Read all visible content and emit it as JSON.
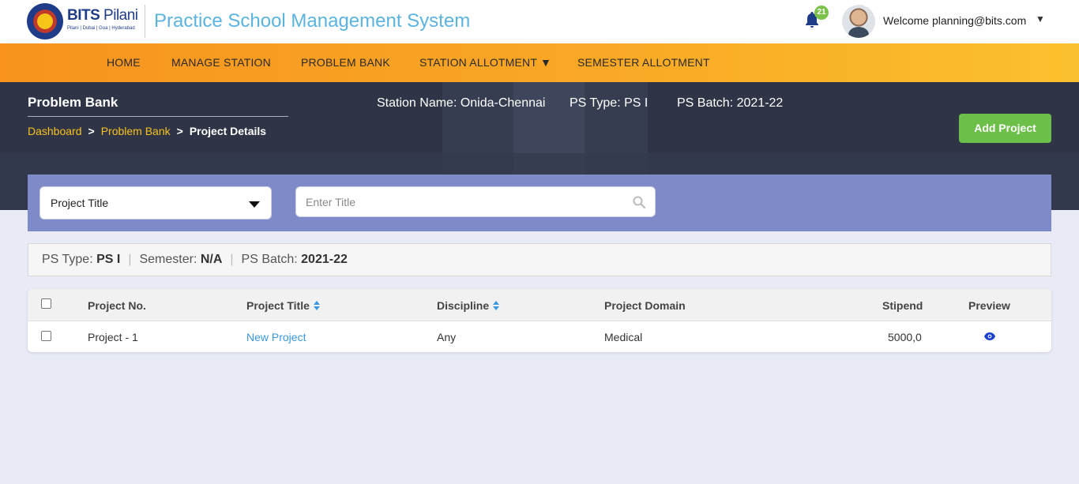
{
  "header": {
    "logo_text_bold": "BITS",
    "logo_text_thin": " Pilani",
    "logo_subtext": "Pilani | Dubai | Goa | Hyderabad",
    "app_title": "Practice School Management System",
    "notification_count": "21",
    "welcome_text": "Welcome planning@bits.com",
    "user_menu_caret": "▼"
  },
  "nav": {
    "items": [
      {
        "label": "HOME"
      },
      {
        "label": "MANAGE STATION"
      },
      {
        "label": "PROBLEM BANK"
      },
      {
        "label": "STATION ALLOTMENT ▼"
      },
      {
        "label": "SEMESTER ALLOTMENT"
      }
    ]
  },
  "hero": {
    "page_title": "Problem Bank",
    "breadcrumb": {
      "items": [
        "Dashboard",
        "Problem Bank",
        "Project Details"
      ],
      "separator": ">"
    },
    "station_name": "Station Name: Onida-Chennai",
    "ps_type": "PS Type: PS I",
    "ps_batch": "PS Batch: 2021-22",
    "add_button": "Add Project"
  },
  "filter": {
    "select_value": "Project Title",
    "search_placeholder": "Enter Title"
  },
  "summary": {
    "ps_type_label": "PS Type: ",
    "ps_type_value": "PS I",
    "semester_label": "Semester: ",
    "semester_value": "N/A",
    "batch_label": "PS Batch: ",
    "batch_value": "2021-22",
    "pipe": "|"
  },
  "table": {
    "headers": {
      "project_no": "Project No.",
      "project_title": "Project Title",
      "discipline": "Discipline",
      "project_domain": "Project Domain",
      "stipend": "Stipend",
      "preview": "Preview"
    },
    "rows": [
      {
        "project_no": "Project - 1",
        "project_title": "New Project",
        "discipline": "Any",
        "project_domain": "Medical",
        "stipend": "5000,0"
      }
    ]
  },
  "colors": {
    "nav_start": "#f7931e",
    "nav_end": "#fbc02d",
    "hero_bg": "#2f3547",
    "filter_bg": "#7e8bc8",
    "accent_link": "#3a98e0",
    "add_button": "#6cc04a",
    "breadcrumb_link": "#f9c21b"
  },
  "icons": [
    "bits-logo",
    "bell-icon",
    "avatar",
    "chevron-down-icon",
    "search-icon",
    "sort-icon",
    "eye-icon",
    "checkbox"
  ]
}
